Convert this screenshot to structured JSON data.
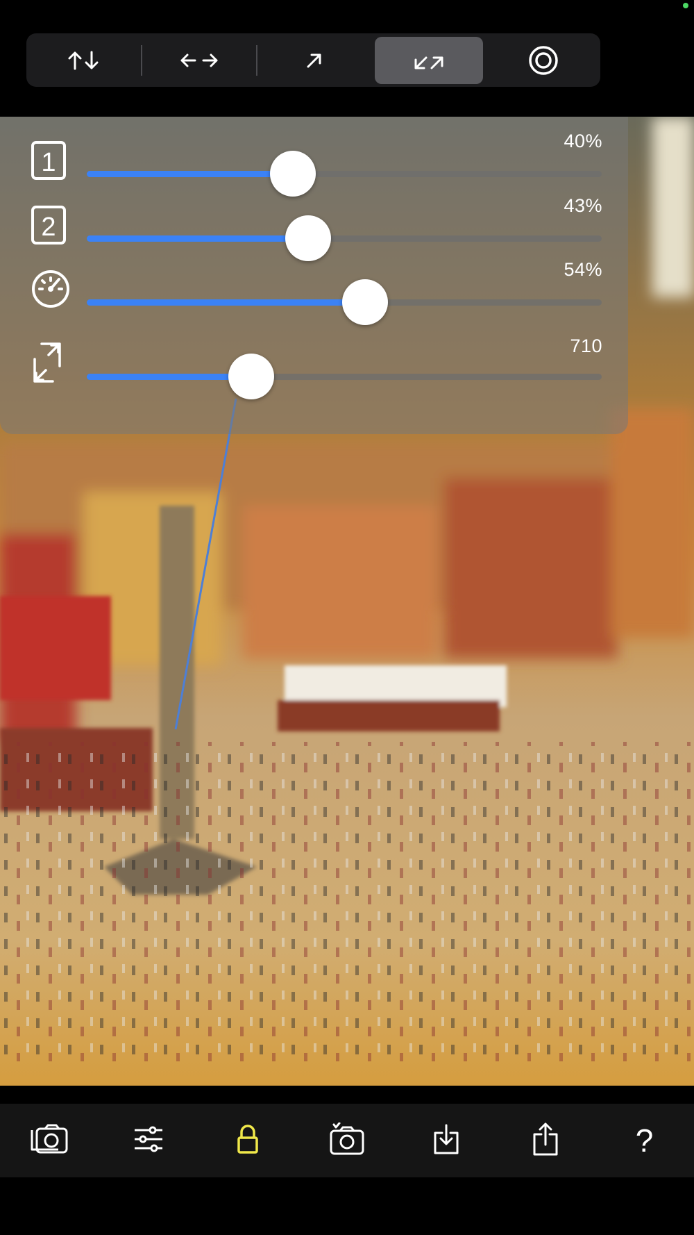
{
  "colors": {
    "accent": "#3b82f6",
    "lock": "#f0e84a",
    "status": "#4cd964"
  },
  "mode_bar": {
    "buttons": [
      {
        "icon": "vertical-arrows-icon",
        "selected": false
      },
      {
        "icon": "horizontal-arrows-icon",
        "selected": false
      },
      {
        "icon": "diagonal-arrow-icon",
        "selected": false
      },
      {
        "icon": "expand-diagonal-icon",
        "selected": true
      },
      {
        "icon": "radial-focus-icon",
        "selected": false
      }
    ]
  },
  "sliders": [
    {
      "icon": "number-1-icon",
      "value": 0.4,
      "label": "40%"
    },
    {
      "icon": "number-2-icon",
      "value": 0.43,
      "label": "43%"
    },
    {
      "icon": "speed-gauge-icon",
      "value": 0.54,
      "label": "54%"
    },
    {
      "icon": "resize-icon",
      "value": 0.32,
      "label": "710"
    }
  ],
  "toolbar": [
    {
      "icon": "camera-switch-icon"
    },
    {
      "icon": "sliders-icon"
    },
    {
      "icon": "lock-icon"
    },
    {
      "icon": "camera-capture-icon"
    },
    {
      "icon": "download-icon"
    },
    {
      "icon": "share-icon"
    },
    {
      "icon": "help-icon",
      "text": "?"
    }
  ]
}
